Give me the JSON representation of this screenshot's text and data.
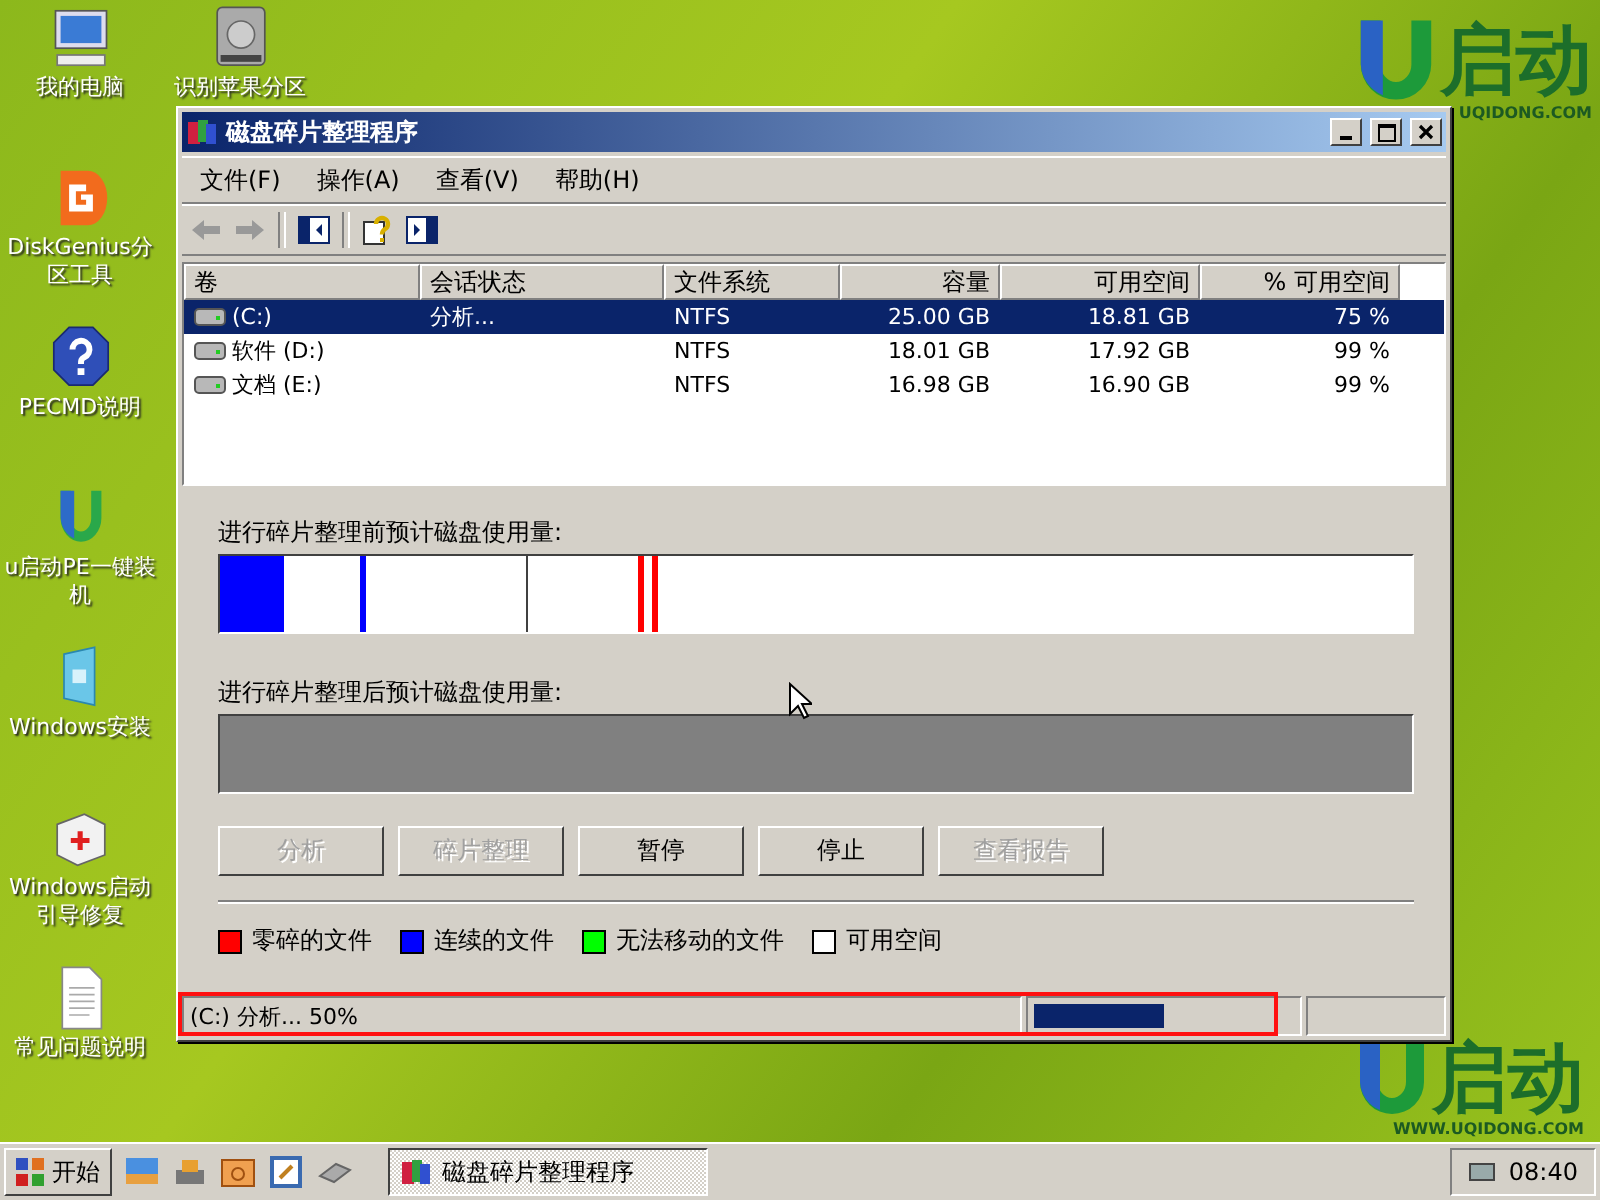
{
  "desktop": {
    "icons": [
      {
        "kind": "computer",
        "label": "我的电脑"
      },
      {
        "kind": "diskgenius",
        "label": "DiskGenius分区工具"
      },
      {
        "kind": "help",
        "label": "PECMD说明"
      },
      {
        "kind": "uqidong",
        "label": "u启动PE一键装机"
      },
      {
        "kind": "install",
        "label": "Windows安装"
      },
      {
        "kind": "toolbox",
        "label": "Windows启动引导修复"
      },
      {
        "kind": "document",
        "label": "常见问题说明"
      },
      {
        "kind": "drive",
        "label": "识别苹果分区"
      }
    ],
    "logo": {
      "name": "启动",
      "site": "UQIDONG.COM"
    },
    "bottom_logo": {
      "name": "启动",
      "site": "WWW.UQIDONG.COM"
    }
  },
  "window": {
    "title": "磁盘碎片整理程序",
    "menu": [
      "文件(F)",
      "操作(A)",
      "查看(V)",
      "帮助(H)"
    ],
    "table": {
      "columns": [
        {
          "label": "卷",
          "kind": "text"
        },
        {
          "label": "会话状态",
          "kind": "text"
        },
        {
          "label": "文件系统",
          "kind": "text"
        },
        {
          "label": "容量",
          "kind": "number"
        },
        {
          "label": "可用空间",
          "kind": "number"
        },
        {
          "label": "% 可用空间",
          "kind": "number"
        }
      ],
      "rows": [
        {
          "selected": true,
          "cells": [
            "(C:)",
            "分析...",
            "NTFS",
            "25.00 GB",
            "18.81 GB",
            "75 %"
          ]
        },
        {
          "selected": false,
          "cells": [
            "软件 (D:)",
            "",
            "NTFS",
            "18.01 GB",
            "17.92 GB",
            "99 %"
          ]
        },
        {
          "selected": false,
          "cells": [
            "文档 (E:)",
            "",
            "NTFS",
            "16.98 GB",
            "16.90 GB",
            "99 %"
          ]
        }
      ]
    },
    "before_label": "进行碎片整理前预计磁盘使用量:",
    "after_label": "进行碎片整理后预计磁盘使用量:",
    "buttons": [
      {
        "label": "分析",
        "disabled": true
      },
      {
        "label": "碎片整理",
        "disabled": true
      },
      {
        "label": "暂停",
        "disabled": false
      },
      {
        "label": "停止",
        "disabled": false
      },
      {
        "label": "查看报告",
        "disabled": true
      }
    ],
    "legend": [
      {
        "label": "零碎的文件",
        "color": "#ff0000"
      },
      {
        "label": "连续的文件",
        "color": "#0000ff"
      },
      {
        "label": "无法移动的文件",
        "color": "#00ff00"
      },
      {
        "label": "可用空间",
        "color": "#ffffff"
      }
    ],
    "status": {
      "text": "(C:) 分析... 50%",
      "level": 0.5
    }
  },
  "taskbar": {
    "start": "开始",
    "task": {
      "label": "磁盘碎片整理程序",
      "selected": true
    },
    "clock": "08:40"
  }
}
